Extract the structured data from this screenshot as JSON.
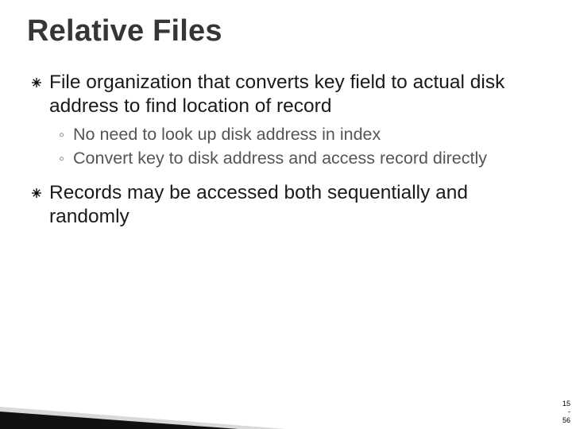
{
  "title": "Relative Files",
  "bullets": [
    {
      "text": "File organization that converts key field to actual disk address to find location of record",
      "sub": [
        "No need to look up disk address in index",
        "Convert key to disk address and access record directly"
      ]
    },
    {
      "text": "Records may be accessed both sequentially and randomly",
      "sub": []
    }
  ],
  "page": {
    "top": "15",
    "mid": "-",
    "bot": "56"
  }
}
